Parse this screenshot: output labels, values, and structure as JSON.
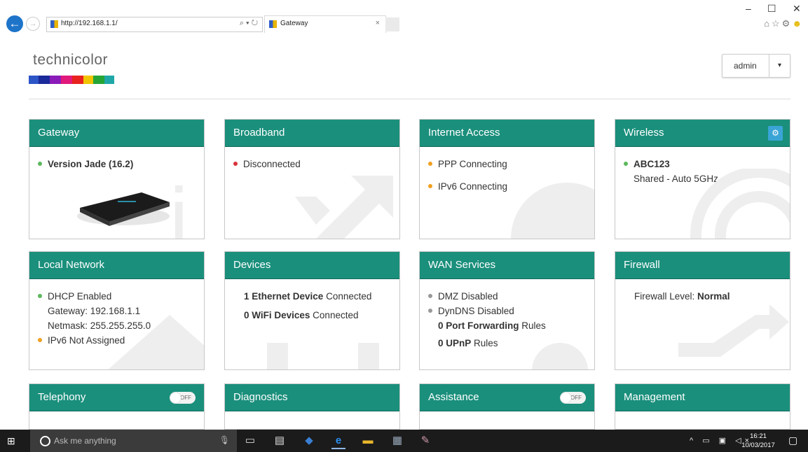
{
  "browser": {
    "url": "http://192.168.1.1/",
    "address_tools": "⌕ ▾ ↻",
    "tab_title": "Gateway",
    "tab_close": "×",
    "back_icon": "←",
    "forward_icon": "→",
    "minimize": "–",
    "restore": "☐",
    "close": "✕",
    "toolbar_icons": {
      "home": "⌂",
      "favorites": "☆",
      "settings": "⚙",
      "smiley": "☻"
    }
  },
  "header": {
    "logo_text": "technicolor",
    "logo_colors": [
      "#2c55c7",
      "#1a2a9a",
      "#8a1bb8",
      "#e0197a",
      "#e8221e",
      "#f0c400",
      "#25a536",
      "#1fa7a8"
    ],
    "user_label": "admin",
    "user_caret": "▾"
  },
  "cards": {
    "gateway": {
      "title": "Gateway",
      "version": "Version Jade (16.2)"
    },
    "broadband": {
      "title": "Broadband",
      "status": "Disconnected"
    },
    "internet": {
      "title": "Internet Access",
      "ppp": "PPP Connecting",
      "ipv6": "IPv6 Connecting"
    },
    "wireless": {
      "title": "Wireless",
      "ssid": "ABC123",
      "mode": "Shared - Auto 5GHz",
      "settings_icon": "⚙"
    },
    "local": {
      "title": "Local Network",
      "dhcp": "DHCP Enabled",
      "gateway": "Gateway: 192.168.1.1",
      "netmask": "Netmask: 255.255.255.0",
      "ipv6": "IPv6 Not Assigned"
    },
    "devices": {
      "title": "Devices",
      "eth_count": "1 Ethernet Device",
      "eth_suffix": " Connected",
      "wifi_count": "0 WiFi Devices",
      "wifi_suffix": " Connected"
    },
    "wan": {
      "title": "WAN Services",
      "dmz": "DMZ Disabled",
      "dyndns": "DynDNS Disabled",
      "pf_count": "0 Port Forwarding",
      "pf_suffix": " Rules",
      "upnp_count": "0 UPnP",
      "upnp_suffix": " Rules"
    },
    "firewall": {
      "title": "Firewall",
      "level_label": "Firewall Level: ",
      "level_value": "Normal"
    },
    "telephony": {
      "title": "Telephony",
      "toggle": "OFF"
    },
    "diagnostics": {
      "title": "Diagnostics"
    },
    "assistance": {
      "title": "Assistance",
      "toggle": "OFF"
    },
    "management": {
      "title": "Management"
    }
  },
  "taskbar": {
    "windows_icon": "⊞",
    "search_placeholder": "Ask me anything",
    "mic_icon": "🎙",
    "tray_icons": "^ ▭ ▣ ◁×",
    "time": "16:21",
    "date": "10/03/2017",
    "notification_icon": "▢"
  }
}
